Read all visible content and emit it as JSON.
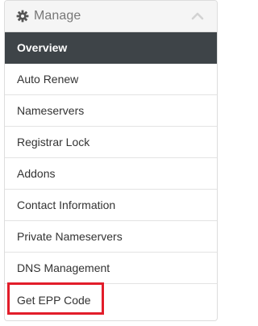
{
  "panel": {
    "title": "Manage",
    "header_icon": "gear-icon",
    "collapse_icon": "chevron-up-icon"
  },
  "menu": {
    "items": [
      {
        "label": "Overview",
        "active": true
      },
      {
        "label": "Auto Renew"
      },
      {
        "label": "Nameservers"
      },
      {
        "label": "Registrar Lock"
      },
      {
        "label": "Addons"
      },
      {
        "label": "Contact Information"
      },
      {
        "label": "Private Nameservers"
      },
      {
        "label": "DNS Management"
      },
      {
        "label": "Get EPP Code",
        "highlighted": true
      }
    ]
  },
  "colors": {
    "active_bg": "#3e4448",
    "highlight_border": "#e21d2a",
    "header_bg": "#f5f5f5"
  }
}
